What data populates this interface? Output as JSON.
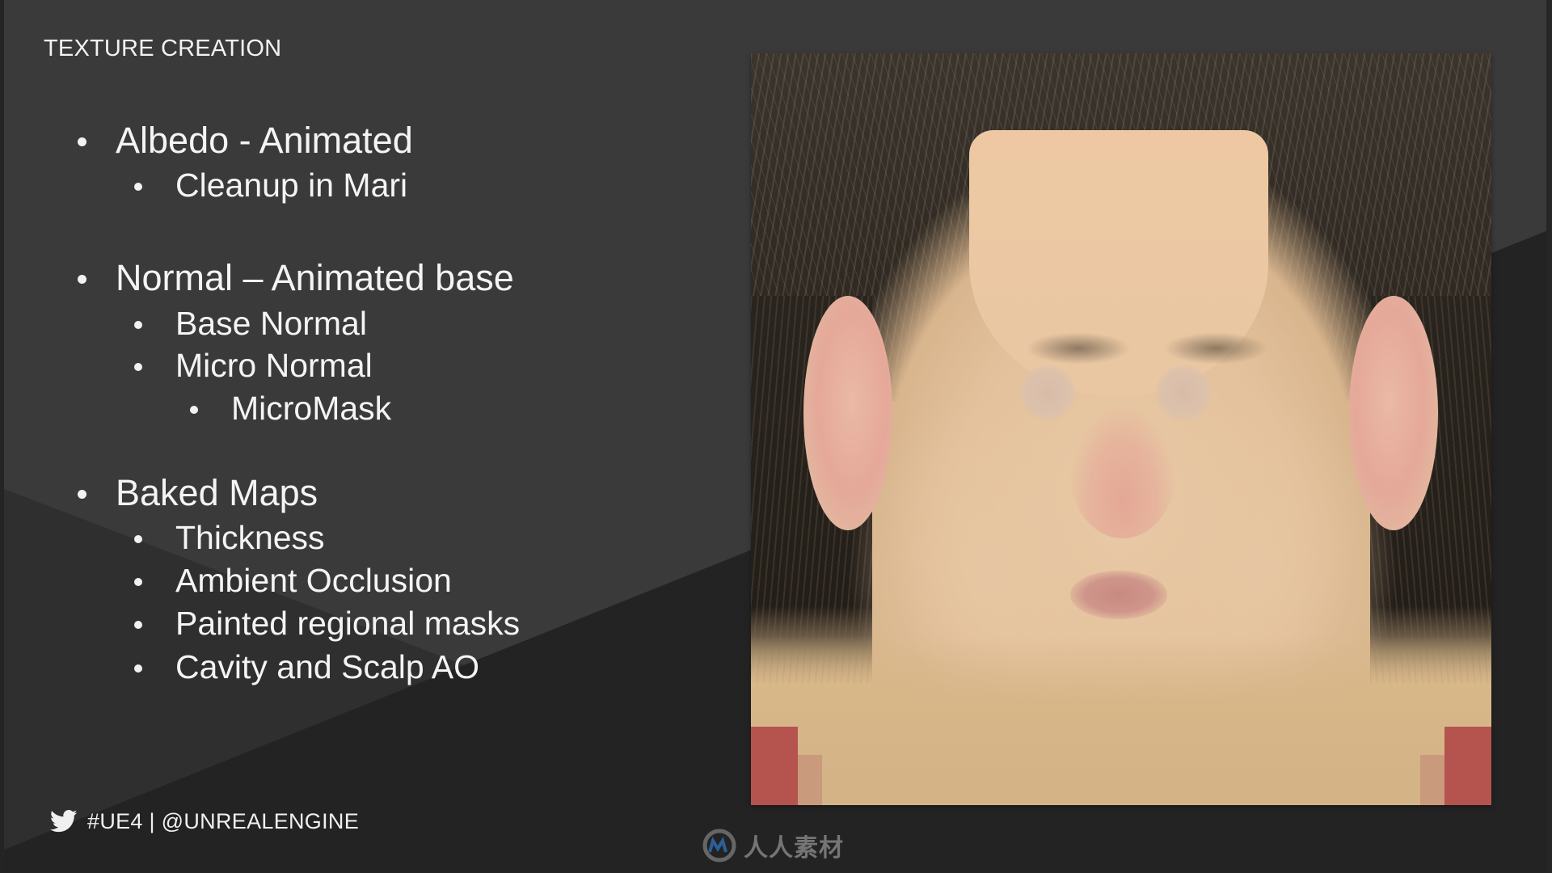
{
  "slide": {
    "title": "TEXTURE CREATION",
    "bullets": [
      {
        "level": 1,
        "text": "Albedo - Animated"
      },
      {
        "level": 2,
        "text": "Cleanup in Mari"
      },
      {
        "level": 1,
        "text": "Normal – Animated base"
      },
      {
        "level": 2,
        "text": "Base Normal"
      },
      {
        "level": 2,
        "text": "Micro Normal"
      },
      {
        "level": 3,
        "text": "MicroMask"
      },
      {
        "level": 1,
        "text": "Baked Maps"
      },
      {
        "level": 2,
        "text": "Thickness"
      },
      {
        "level": 2,
        "text": "Ambient Occlusion"
      },
      {
        "level": 2,
        "text": "Painted regional masks"
      },
      {
        "level": 2,
        "text": "Cavity and Scalp AO"
      }
    ],
    "image": {
      "alt": "Unwrapped head albedo texture map",
      "icon": "image"
    }
  },
  "footer": {
    "icon": "twitter-bird-icon",
    "handle": "#UE4 | @UNREALENGINE"
  },
  "watermark": {
    "icon": "rrsc-logo-icon",
    "text": "人人素材"
  },
  "colors": {
    "background": "#3a3a3a",
    "band": "#2f2f2f",
    "dark": "#222222",
    "text": "#f2f2f2"
  }
}
